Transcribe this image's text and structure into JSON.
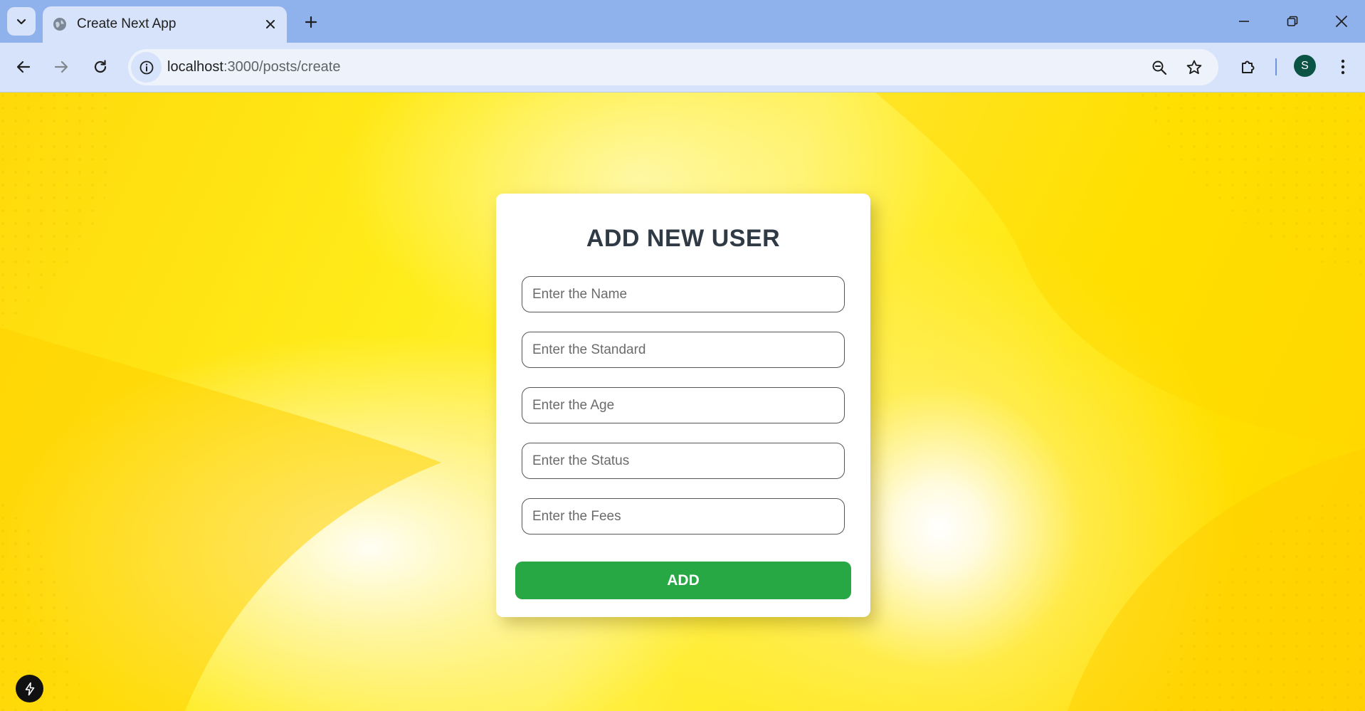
{
  "browser": {
    "tab": {
      "title": "Create Next App",
      "favicon": "globe-icon"
    },
    "address_bar": {
      "host": "localhost",
      "path": ":3000/posts/create"
    },
    "profile_initial": "S"
  },
  "form": {
    "title": "ADD NEW USER",
    "fields": {
      "name": {
        "placeholder": "Enter the Name",
        "value": ""
      },
      "standard": {
        "placeholder": "Enter the Standard",
        "value": ""
      },
      "age": {
        "placeholder": "Enter the Age",
        "value": ""
      },
      "status": {
        "placeholder": "Enter the Status",
        "value": ""
      },
      "fees": {
        "placeholder": "Enter the Fees",
        "value": ""
      }
    },
    "submit_label": "ADD"
  },
  "colors": {
    "tab_strip": "#8fb1ec",
    "toolbar": "#d6e3fa",
    "submit_button": "#28a745",
    "title_text": "#2f3a45",
    "avatar": "#0b5345",
    "background_yellow": "#ffe600"
  }
}
